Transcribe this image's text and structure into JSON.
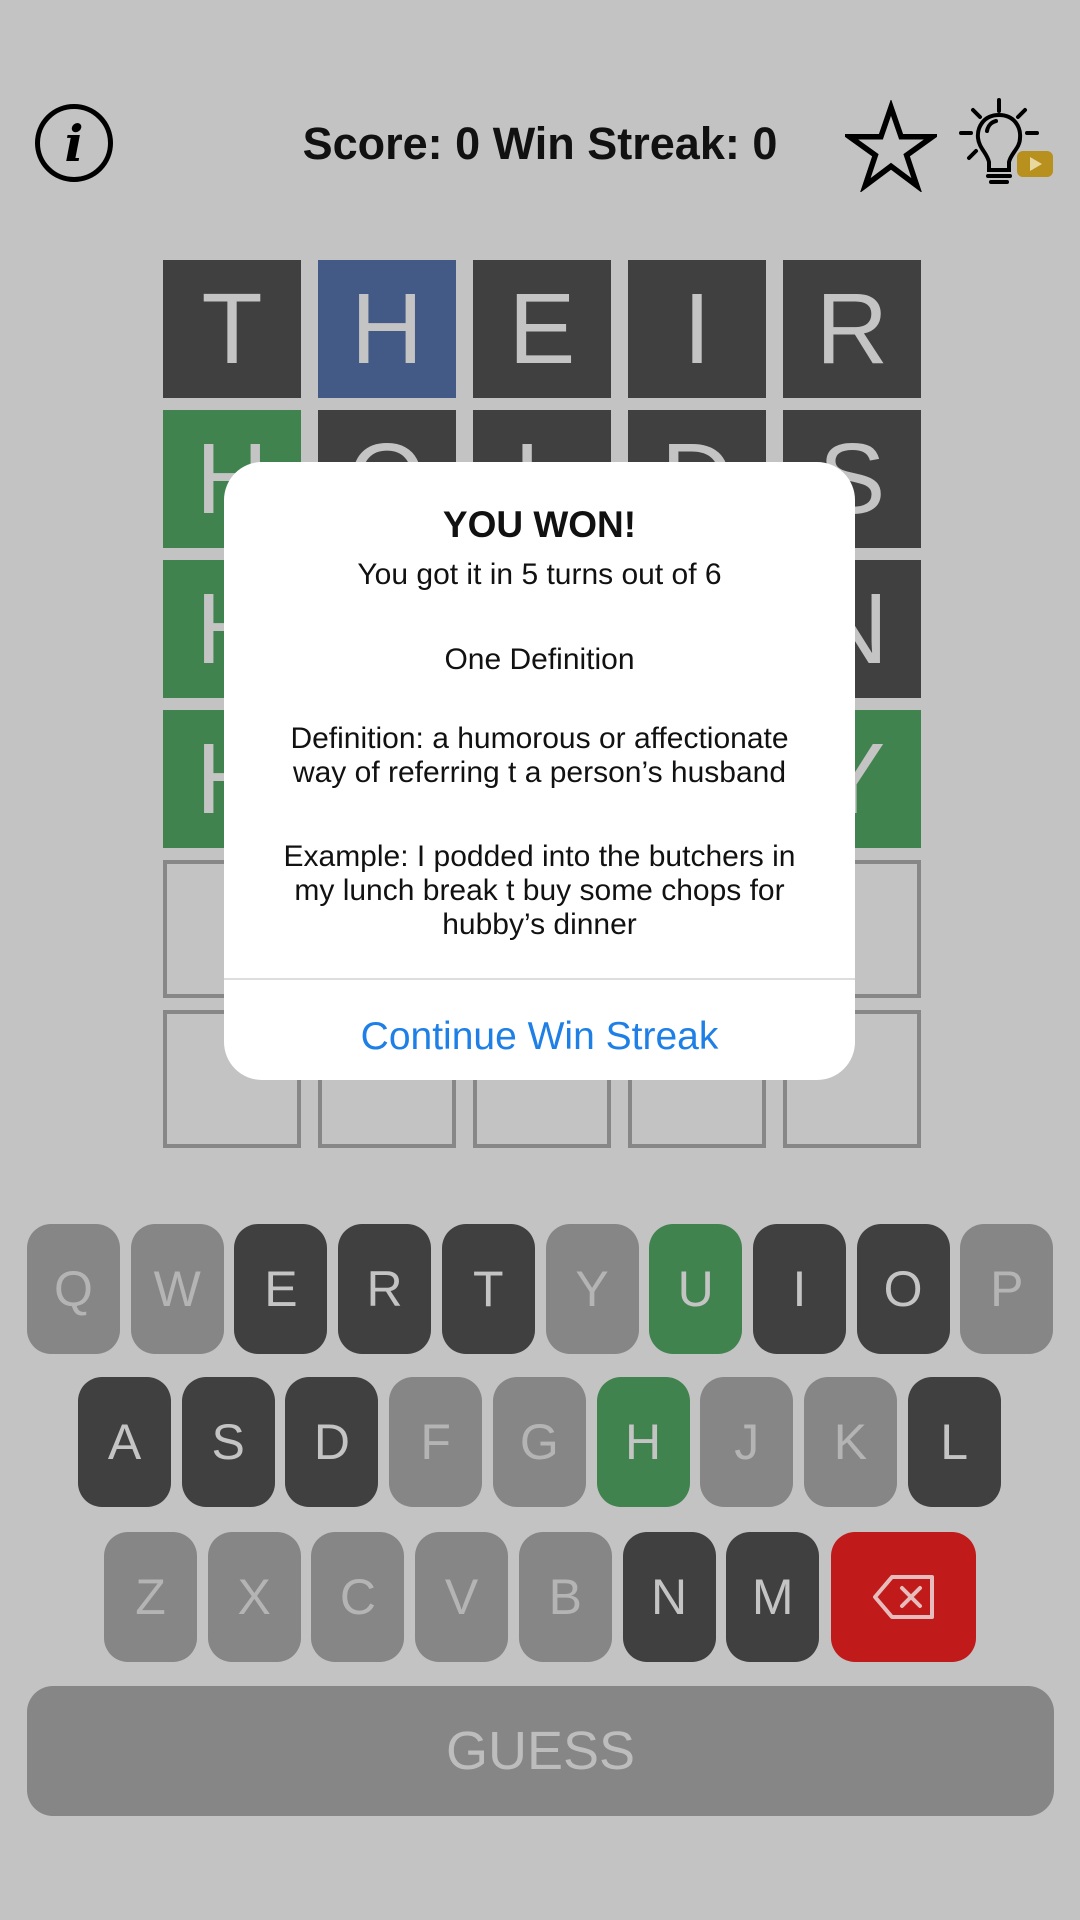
{
  "header": {
    "info_icon": "info-icon",
    "score_text": "Score: 0 Win Streak: 0",
    "star_icon": "star-icon",
    "hint_icon": "lightbulb-video-hint-icon",
    "hint_badge_color": "#b8901e"
  },
  "colors": {
    "absent": "#404040",
    "present": "#425a85",
    "correct": "#41834f",
    "unused": "#868686",
    "delete": "#c01a1a",
    "link": "#1e7fe6"
  },
  "grid": [
    [
      {
        "l": "T",
        "s": "dark"
      },
      {
        "l": "H",
        "s": "blue"
      },
      {
        "l": "E",
        "s": "dark"
      },
      {
        "l": "I",
        "s": "dark"
      },
      {
        "l": "R",
        "s": "dark"
      }
    ],
    [
      {
        "l": "H",
        "s": "green"
      },
      {
        "l": "O",
        "s": "dark"
      },
      {
        "l": "L",
        "s": "dark"
      },
      {
        "l": "D",
        "s": "dark"
      },
      {
        "l": "S",
        "s": "dark"
      }
    ],
    [
      {
        "l": "H",
        "s": "green"
      },
      {
        "l": "",
        "s": "dark"
      },
      {
        "l": "",
        "s": "dark"
      },
      {
        "l": "",
        "s": "dark"
      },
      {
        "l": "N",
        "s": "dark"
      }
    ],
    [
      {
        "l": "H",
        "s": "green"
      },
      {
        "l": "",
        "s": "green"
      },
      {
        "l": "",
        "s": "green"
      },
      {
        "l": "",
        "s": "green"
      },
      {
        "l": "Y",
        "s": "green"
      }
    ],
    [
      {
        "l": "",
        "s": "empty"
      },
      {
        "l": "",
        "s": "empty"
      },
      {
        "l": "",
        "s": "empty"
      },
      {
        "l": "",
        "s": "empty"
      },
      {
        "l": "",
        "s": "empty"
      }
    ],
    [
      {
        "l": "",
        "s": "empty"
      },
      {
        "l": "",
        "s": "empty"
      },
      {
        "l": "",
        "s": "empty"
      },
      {
        "l": "",
        "s": "empty"
      },
      {
        "l": "",
        "s": "empty"
      }
    ]
  ],
  "modal": {
    "title": "YOU WON!",
    "subtitle": "You got it in 5 turns out of 6",
    "definition_heading": "One Definition",
    "definition": "Definition: a humorous or affectionate way of referring t a person’s husband",
    "example": "Example: I podded into the butchers in my lunch break t buy some chops for hubby’s dinner",
    "continue_label": "Continue Win Streak"
  },
  "keyboard": {
    "rows": [
      [
        {
          "k": "Q",
          "s": "unused"
        },
        {
          "k": "W",
          "s": "unused"
        },
        {
          "k": "E",
          "s": "absent"
        },
        {
          "k": "R",
          "s": "absent"
        },
        {
          "k": "T",
          "s": "absent"
        },
        {
          "k": "Y",
          "s": "unused"
        },
        {
          "k": "U",
          "s": "correct"
        },
        {
          "k": "I",
          "s": "absent"
        },
        {
          "k": "O",
          "s": "absent"
        },
        {
          "k": "P",
          "s": "unused"
        }
      ],
      [
        {
          "k": "A",
          "s": "absent"
        },
        {
          "k": "S",
          "s": "absent"
        },
        {
          "k": "D",
          "s": "absent"
        },
        {
          "k": "F",
          "s": "unused"
        },
        {
          "k": "G",
          "s": "unused"
        },
        {
          "k": "H",
          "s": "correct"
        },
        {
          "k": "J",
          "s": "unused"
        },
        {
          "k": "K",
          "s": "unused"
        },
        {
          "k": "L",
          "s": "absent"
        }
      ],
      [
        {
          "k": "Z",
          "s": "unused"
        },
        {
          "k": "X",
          "s": "unused"
        },
        {
          "k": "C",
          "s": "unused"
        },
        {
          "k": "V",
          "s": "unused"
        },
        {
          "k": "B",
          "s": "unused"
        },
        {
          "k": "N",
          "s": "absent"
        },
        {
          "k": "M",
          "s": "absent"
        }
      ]
    ],
    "delete_icon": "backspace-icon",
    "guess_label": "GUESS"
  }
}
